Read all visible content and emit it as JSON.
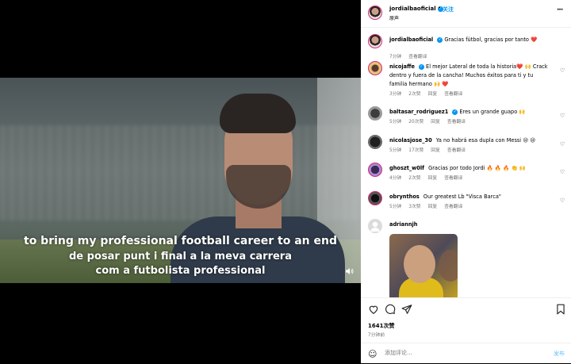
{
  "video": {
    "subtitle_lines": [
      "to bring my professional football career to an end",
      "de posar punt i final a la meva carrera",
      "com a futbolista professional"
    ]
  },
  "header": {
    "username": "jordialbaoficial",
    "follow_label": "关注",
    "subtitle": "原声",
    "more_icon": "more-icon"
  },
  "caption": {
    "username": "jordialbaoficial",
    "text": "Gracias fútbol, gracias por tanto ❤️",
    "time": "7分钟",
    "translate": "查看翻译"
  },
  "comments": [
    {
      "username": "nicojaffe",
      "verified": true,
      "text": "El mejor Lateral de toda la historia❤️ 🙌 Crack dentro y fuera de la cancha! Muchos éxitos para ti y tu familia hermano 🙌 ❤️",
      "time": "3分钟",
      "likes": "2次赞",
      "reply": "回复",
      "translate": "查看翻译"
    },
    {
      "username": "baltasar_rodriguez1",
      "verified": true,
      "text": "Eres un grande guapo 🙌",
      "time": "5分钟",
      "likes": "20次赞",
      "reply": "回复",
      "translate": "查看翻译"
    },
    {
      "username": "nicolasjose_30",
      "verified": false,
      "text": "Ya no habrá esa dupla con Messi 😢 😢",
      "time": "5分钟",
      "likes": "17次赞",
      "reply": "回复",
      "translate": "查看翻译"
    },
    {
      "username": "ghoszt_w0lf",
      "verified": false,
      "text": "Gracias por todo Jordi 🔥 🔥 🔥 👏 🙌",
      "time": "4分钟",
      "likes": "2次赞",
      "reply": "回复",
      "translate": "查看翻译"
    },
    {
      "username": "obrynthos",
      "verified": false,
      "text": "Our greatest Lb \"Visca Barca\"",
      "time": "5分钟",
      "likes": "3次赞",
      "reply": "回复",
      "translate": "查看翻译"
    },
    {
      "username": "adriannjh",
      "verified": false,
      "text": "",
      "time": "",
      "likes": "",
      "reply": "",
      "translate": ""
    }
  ],
  "actions": {
    "likes_count": "1641次赞",
    "time_ago": "7分钟前",
    "comment_placeholder": "添加评论...",
    "post_label": "发布"
  },
  "colors": {
    "accent": "#0095f6",
    "muted": "#737373"
  }
}
